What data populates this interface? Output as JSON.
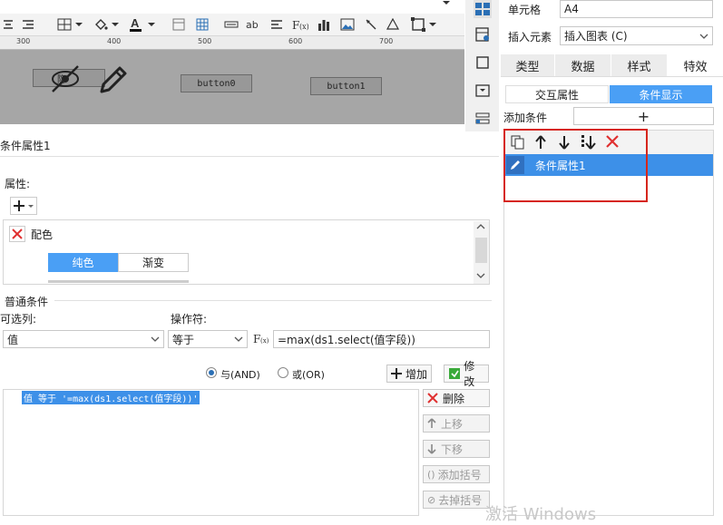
{
  "ruler": {
    "ticks": [
      "300",
      "400",
      "500",
      "600",
      "700"
    ]
  },
  "canvas": {
    "button0_label": "button0",
    "button1_label": "button1",
    "truncated_label": "隐"
  },
  "right": {
    "cell_label": "单元格",
    "cell_value": "A4",
    "insert_label": "插入元素",
    "insert_value": "插入图表 (C)",
    "tabs": [
      "类型",
      "数据",
      "样式",
      "特效"
    ],
    "subtabs": [
      "交互属性",
      "条件显示"
    ],
    "add_condition_label": "添加条件",
    "add_button": "+",
    "list_item": "条件属性1"
  },
  "left": {
    "title": "条件属性1",
    "attr_label": "属性:",
    "color_label": "配色",
    "solid_label": "纯色",
    "gradient_label": "渐变",
    "common_label": "普通条件",
    "column_label": "可选列:",
    "operator_label": "操作符:",
    "column_value": "值",
    "operator_value": "等于",
    "formula_value": "=max(ds1.select(值字段))",
    "and_label": "与(AND)",
    "or_label": "或(OR)",
    "add_label": "增加",
    "modify_label": "修改",
    "condition_row": "值 等于 '=max(ds1.select(值字段))'",
    "delete_label": "删除",
    "up_label": "上移",
    "down_label": "下移",
    "add_paren_label": "添加括号",
    "remove_paren_label": "去掉括号"
  },
  "watermark": "激活 Windows",
  "colors": {
    "accent": "#4a9ff5",
    "selected": "#3d90e8",
    "red": "#e03030",
    "highlight": "#d6261c"
  }
}
